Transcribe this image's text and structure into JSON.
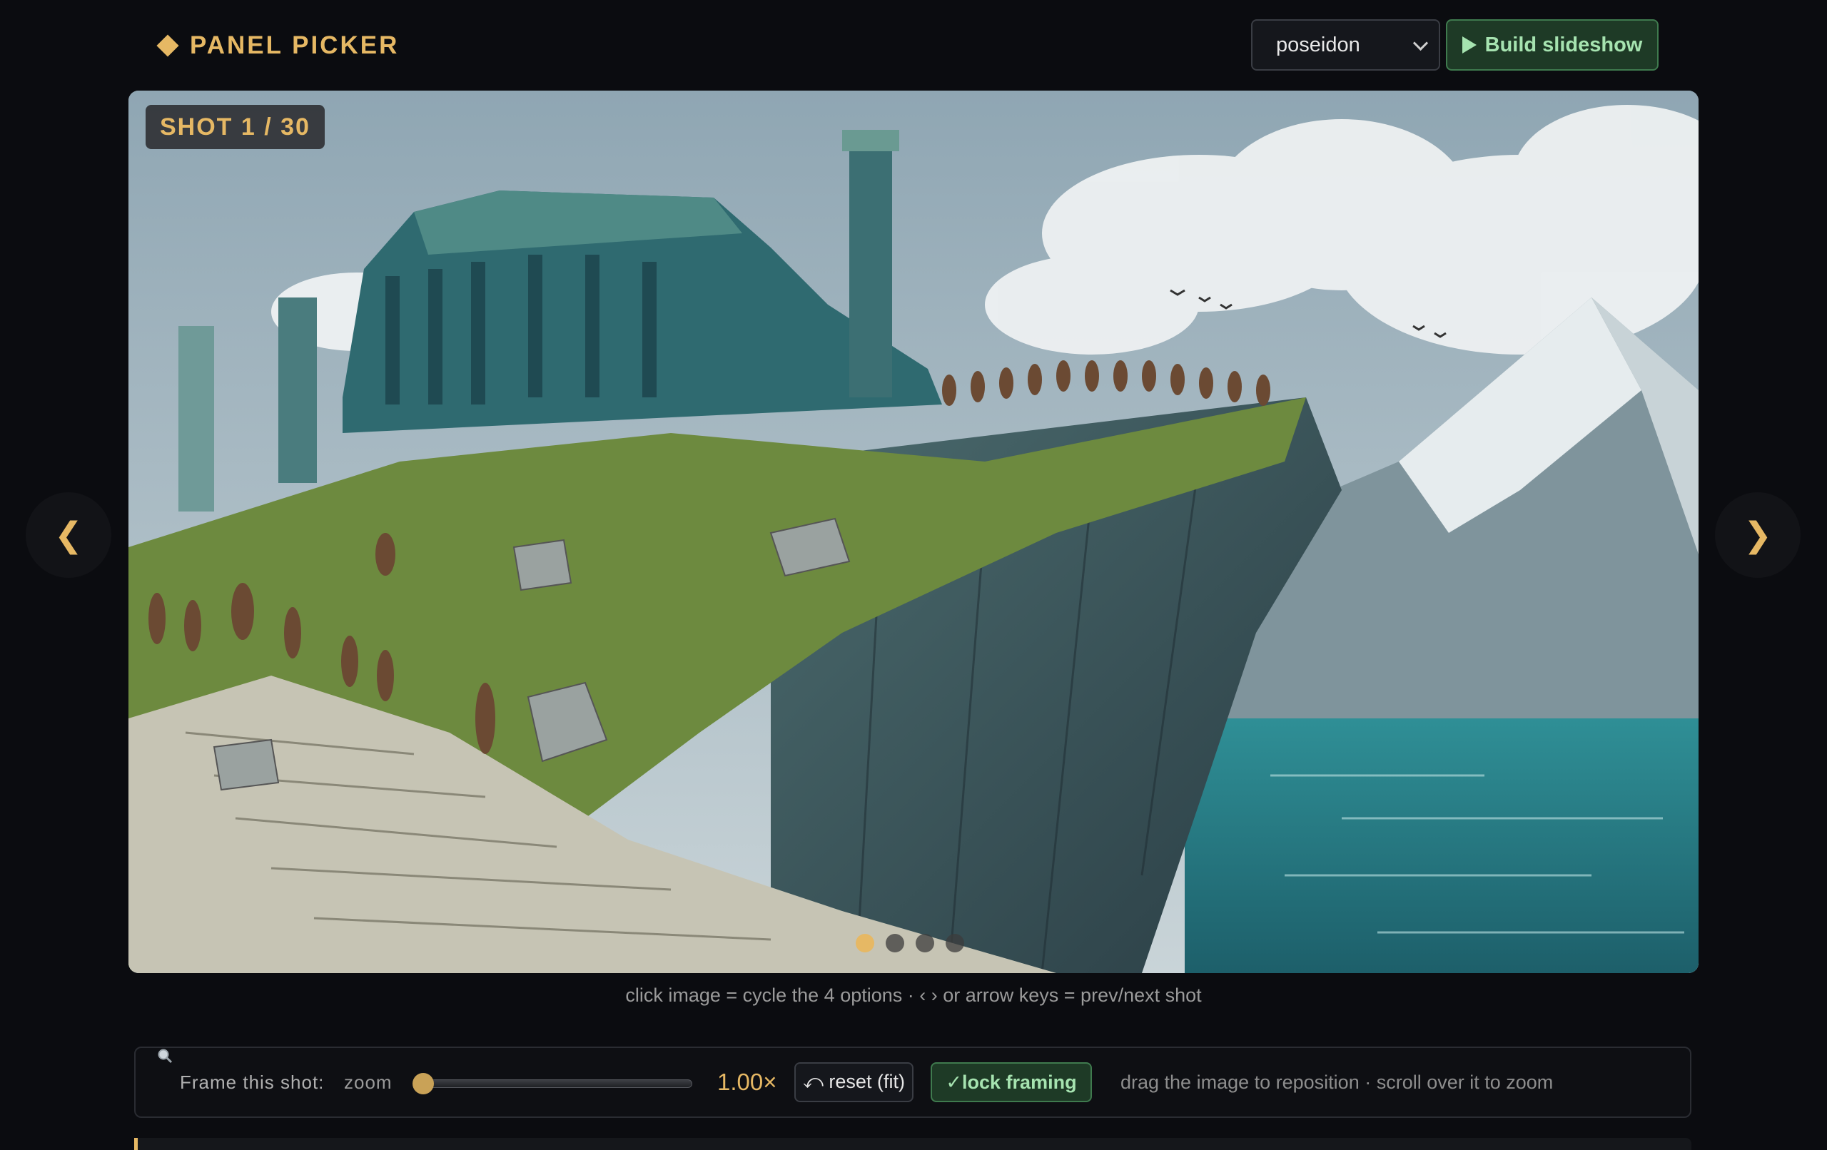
{
  "header": {
    "brand_title": "PANEL PICKER",
    "project_select": {
      "selected": "poseidon"
    },
    "build_button_label": "Build slideshow"
  },
  "viewer": {
    "shot_badge": "SHOT 1 / 30",
    "options_total": 4,
    "active_option": 1,
    "prev_label": "❮",
    "next_label": "❯"
  },
  "hint": "click image = cycle the 4 options · ‹ › or arrow keys = prev/next shot",
  "framing": {
    "label": "Frame this shot:",
    "zoom_label": "zoom",
    "zoom_value": "1.00×",
    "zoom_level": 1.0,
    "reset_label": "⤺ reset (fit)",
    "lock_label": "✓lock framing",
    "drag_hint": "drag the image to reposition · scroll over it to zoom"
  },
  "colors": {
    "accent": "#e6b864",
    "success": "#a6e3b0",
    "background": "#0b0c10"
  }
}
